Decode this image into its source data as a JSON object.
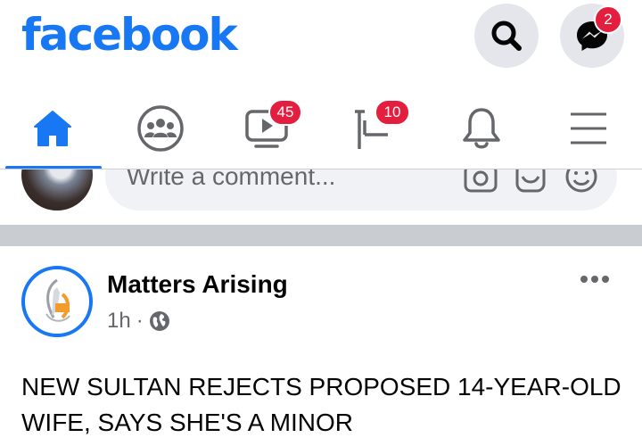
{
  "header": {
    "logo": "facebook",
    "messenger_badge": "2"
  },
  "tabs": {
    "watch_badge": "45",
    "feeds_badge": "10"
  },
  "comment": {
    "placeholder": "Write a comment..."
  },
  "post": {
    "author": "Matters Arising",
    "time": "1h",
    "separator": "·",
    "text": "NEW SULTAN REJECTS PROPOSED 14-YEAR-OLD WIFE, SAYS SHE'S A MINOR"
  },
  "colors": {
    "brand": "#1877f2",
    "badge": "#e41e3f",
    "icon": "#65676b"
  },
  "icons": [
    "search-icon",
    "messenger-icon",
    "home-icon",
    "groups-icon",
    "watch-icon",
    "feeds-icon",
    "bell-icon",
    "menu-icon",
    "camera-icon",
    "gif-icon",
    "smiley-icon",
    "globe-icon",
    "more-icon"
  ]
}
